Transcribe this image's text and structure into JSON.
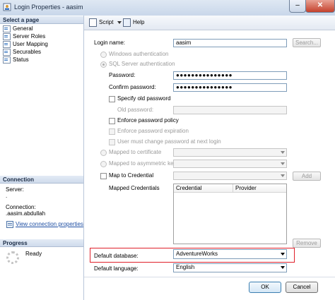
{
  "window": {
    "title": "Login Properties - aasim",
    "close_glyph": "✕",
    "minimize_glyph": "–"
  },
  "left": {
    "select_page_header": "Select a page",
    "pages": [
      "General",
      "Server Roles",
      "User Mapping",
      "Securables",
      "Status"
    ],
    "connection_header": "Connection",
    "server_label": "Server:",
    "server_value": ".",
    "connection_label": "Connection:",
    "connection_value": ".aasim.abdullah",
    "view_connection_link": "View connection properties",
    "progress_header": "Progress",
    "progress_status": "Ready"
  },
  "toolbar": {
    "script_label": "Script",
    "help_label": "Help"
  },
  "general": {
    "login_name_label": "Login name:",
    "login_name_value": "aasim",
    "search_button": "Search...",
    "windows_auth": "Windows authentication",
    "sql_auth": "SQL Server authentication",
    "password_label": "Password:",
    "password_value": "●●●●●●●●●●●●●●●",
    "confirm_label": "Confirm password:",
    "confirm_value": "●●●●●●●●●●●●●●●",
    "specify_old": "Specify old password",
    "old_password_label": "Old password:",
    "enforce_policy": "Enforce password policy",
    "enforce_expiration": "Enforce password expiration",
    "must_change": "User must change password at next login",
    "mapped_cert": "Mapped to certificate",
    "mapped_asym": "Mapped to asymmetric key",
    "map_credential": "Map to Credential",
    "add_button": "Add",
    "mapped_credentials_label": "Mapped Credentials",
    "grid_col_credential": "Credential",
    "grid_col_provider": "Provider",
    "remove_button": "Remove",
    "default_db_label": "Default database:",
    "default_db_value": "AdventureWorks",
    "default_lang_label": "Default language:",
    "default_lang_value": "English"
  },
  "footer": {
    "ok_button": "OK",
    "cancel_button": "Cancel"
  },
  "colors": {
    "highlight_red": "#e0202a",
    "link": "#1f4fa3"
  }
}
